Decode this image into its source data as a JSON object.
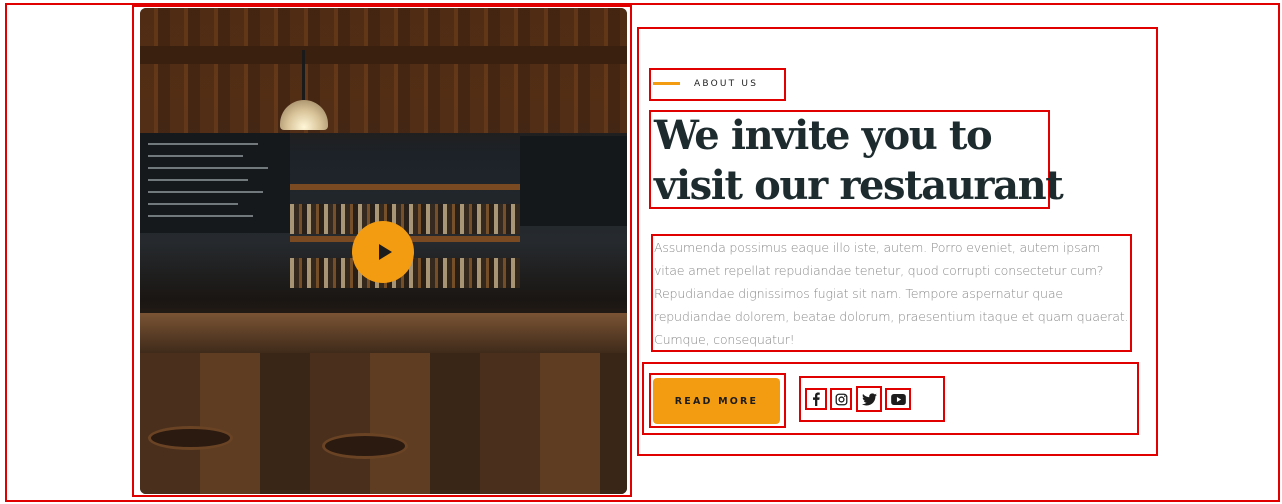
{
  "about": {
    "eyebrow": "ABOUT US",
    "heading_line1": "We invite you to",
    "heading_line2": "visit our restaurant",
    "paragraph": "Assumenda possimus eaque illo iste, autem. Porro eveniet, autem ipsam vitae amet repellat repudiandae tenetur, quod corrupti consectetur cum? Repudiandae dignissimos fugiat sit nam. Tempore aspernatur quae repudiandae dolorem, beatae dolorum, praesentium itaque et quam quaerat. Cumque, consequatur!",
    "read_more_label": "READ MORE"
  },
  "media": {
    "image_subject": "bar interior photo",
    "play_icon": "play-icon"
  },
  "social": [
    {
      "name": "facebook-icon"
    },
    {
      "name": "instagram-icon"
    },
    {
      "name": "twitter-icon"
    },
    {
      "name": "youtube-icon"
    }
  ],
  "colors": {
    "accent": "#f39c12",
    "heading": "#1d2b2f",
    "body_text": "#8a8a8a",
    "outline": "#e00000"
  }
}
